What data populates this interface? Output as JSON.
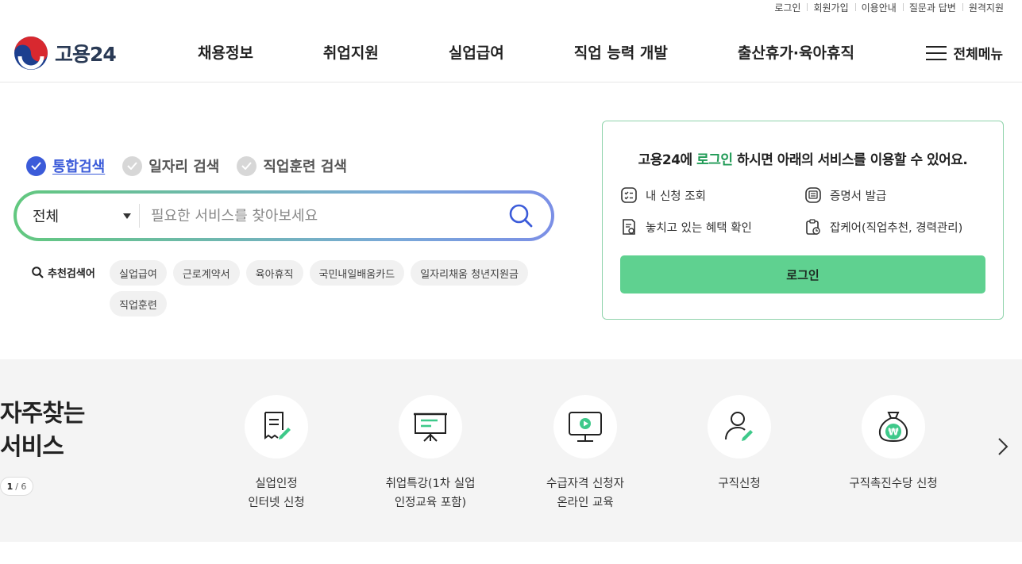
{
  "util_links": [
    "로그인",
    "회원가입",
    "이용안내",
    "질문과 답변",
    "원격지원"
  ],
  "logo": {
    "text": "고용24"
  },
  "gnb": [
    "채용정보",
    "취업지원",
    "실업급여",
    "직업 능력 개발",
    "출산휴가·육아휴직"
  ],
  "all_menu_label": "전체메뉴",
  "search": {
    "tabs": [
      {
        "label": "통합검색",
        "active": true
      },
      {
        "label": "일자리 검색",
        "active": false
      },
      {
        "label": "직업훈련 검색",
        "active": false
      }
    ],
    "category": "전체",
    "placeholder": "필요한 서비스를 찾아보세요"
  },
  "recommended": {
    "label": "추천검색어",
    "keywords": [
      "실업급여",
      "근로계약서",
      "육아휴직",
      "국민내일배움카드",
      "일자리채움 청년지원금",
      "직업훈련"
    ]
  },
  "login_panel": {
    "title_pre": "고용24에 ",
    "title_highlight": "로그인",
    "title_post": " 하시면 아래의 서비스를 이용할 수 있어요.",
    "services": [
      "내 신청 조회",
      "증명서 발급",
      "놓치고 있는 혜택 확인",
      "잡케어(직업추천, 경력관리)"
    ],
    "button": "로그인"
  },
  "frequent": {
    "title_line1": "자주찾는",
    "title_line2": "서비스",
    "page_current": "1",
    "page_total": "6",
    "items": [
      {
        "line1": "실업인정",
        "line2": "인터넷 신청",
        "icon": "document-pen-icon"
      },
      {
        "line1": "취업특강(1차 실업",
        "line2": "인정교육 포함)",
        "icon": "presentation-board-icon"
      },
      {
        "line1": "수급자격 신청자",
        "line2": "온라인 교육",
        "icon": "video-monitor-icon"
      },
      {
        "line1": "구직신청",
        "line2": "",
        "icon": "person-pen-icon"
      },
      {
        "line1": "구직촉진수당 신청",
        "line2": "",
        "icon": "money-bag-icon"
      }
    ]
  },
  "colors": {
    "brand_green": "#5fd190",
    "accent_blue": "#3b5bd9",
    "highlight_green": "#1f9a55"
  }
}
